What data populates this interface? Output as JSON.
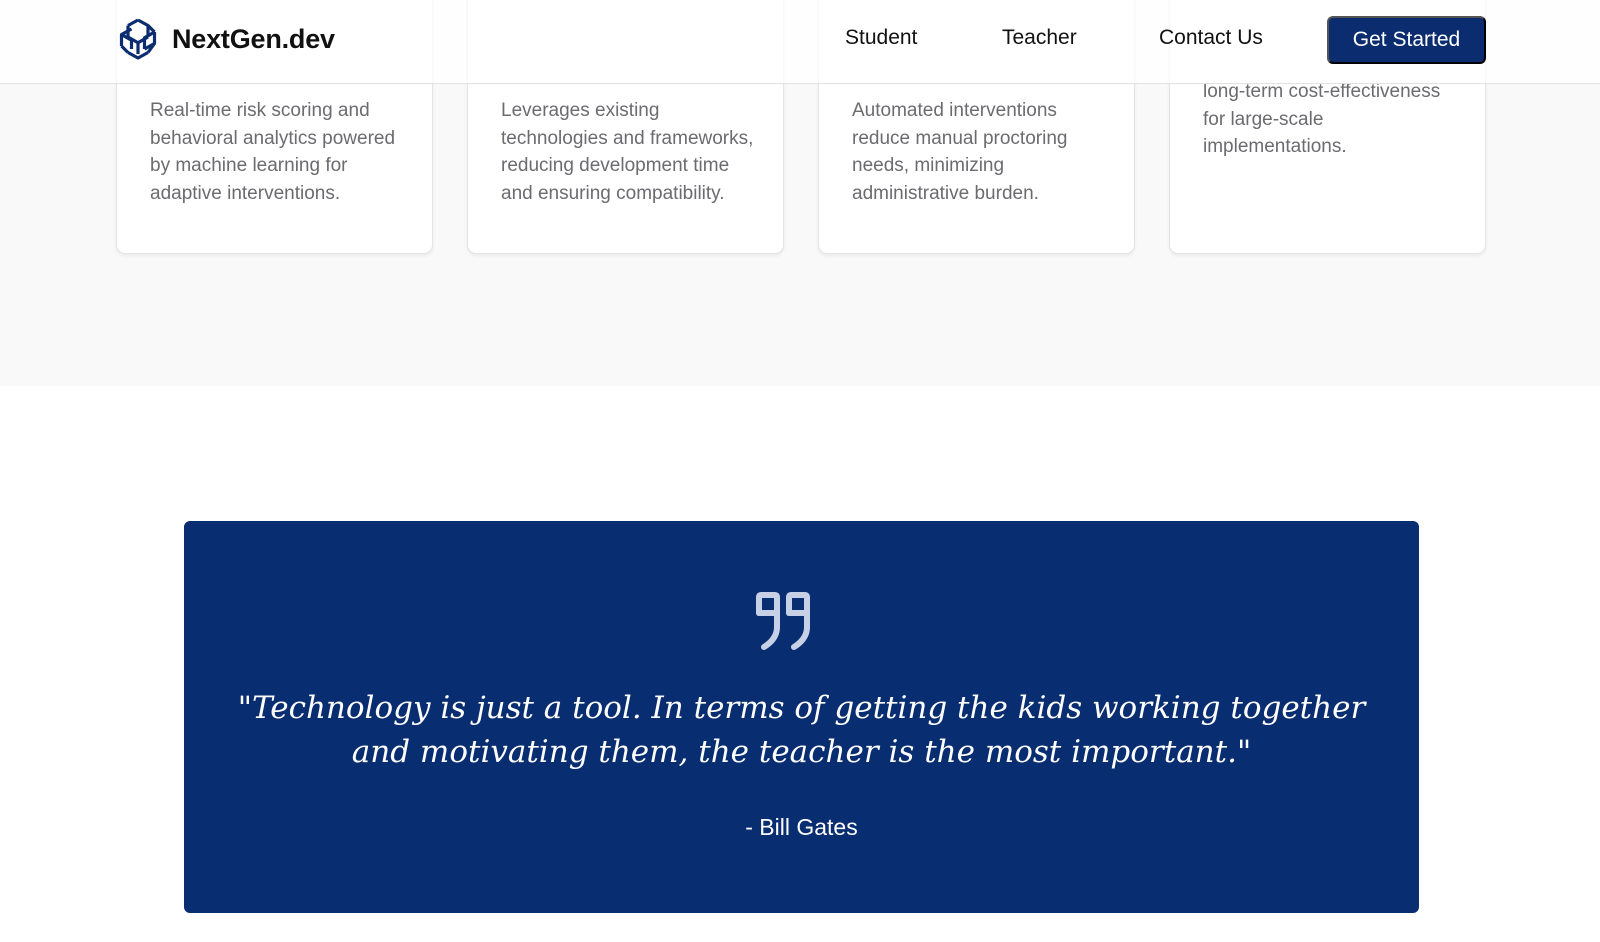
{
  "header": {
    "logo_text": "NextGen.dev",
    "nav": [
      "Student",
      "Teacher",
      "Contact Us"
    ],
    "cta_label": "Get Started"
  },
  "features": {
    "cards": [
      {
        "title": "",
        "description": "Real-time risk scoring and behavioral analytics powered by machine learning for adaptive interventions."
      },
      {
        "title": "",
        "description": "Leverages existing technologies and frameworks, reducing development time and ensuring compatibility."
      },
      {
        "title": "",
        "description": "Automated interventions reduce manual proctoring needs, minimizing administrative burden."
      },
      {
        "title": "",
        "description": "long-term cost-effectiveness for large-scale implementations."
      }
    ]
  },
  "quote": {
    "text": "\"Technology is just a tool. In terms of getting the kids working together and motivating them, the teacher is the most important.\"",
    "author": "- Bill Gates"
  },
  "colors": {
    "brand": "#0b2d6f",
    "quote_bg": "#082d70",
    "section_bg": "#f9f9f9"
  },
  "icons": {
    "logo": "knot-logo-icon",
    "quote": "quote-icon"
  }
}
